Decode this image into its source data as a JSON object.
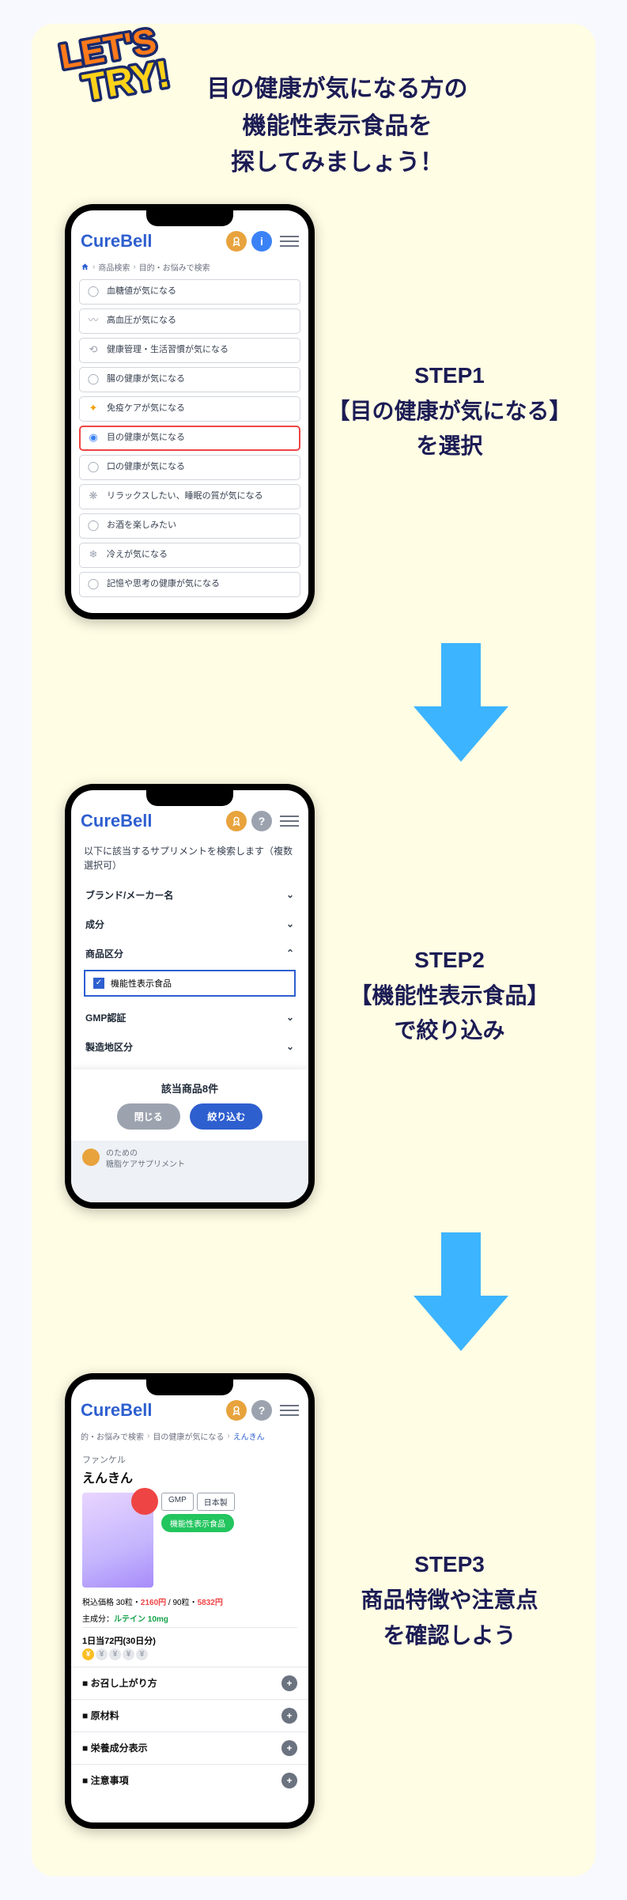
{
  "headline": {
    "l1": "目の健康が気になる方の",
    "l2": "機能性表示食品を",
    "l3": "探してみましょう！"
  },
  "badge_text": "LET'S TRY!",
  "app": {
    "logo": "CureBell"
  },
  "phone1": {
    "breadcrumb": {
      "a": "商品検索",
      "b": "目的・お悩みで検索"
    },
    "cats": [
      "血糖値が気になる",
      "高血圧が気になる",
      "健康管理・生活習慣が気になる",
      "腸の健康が気になる",
      "免疫ケアが気になる",
      "目の健康が気になる",
      "口の健康が気になる",
      "リラックスしたい、睡眠の質が気になる",
      "お酒を楽しみたい",
      "冷えが気になる",
      "記憶や思考の健康が気になる"
    ],
    "highlight_index": 5
  },
  "step1": {
    "title": "STEP1",
    "l1": "【目の健康が気になる】",
    "l2": "を選択"
  },
  "phone2": {
    "msg": "以下に該当するサプリメントを検索します（複数選択可）",
    "rows": [
      "ブランド/メーカー名",
      "成分",
      "商品区分",
      "GMP認証",
      "製造地区分"
    ],
    "checked_option": "機能性表示食品",
    "count_label": "該当商品8件",
    "btn_close": "閉じる",
    "btn_filter": "絞り込む",
    "bg_l1": "のための",
    "bg_l2": "糖脂ケアサプリメント"
  },
  "step2": {
    "title": "STEP2",
    "l1": "【機能性表示食品】",
    "l2": "で絞り込み"
  },
  "phone3": {
    "breadcrumb": {
      "a": "的・お悩みで検索",
      "b": "目の健康が気になる",
      "c": "えんきん"
    },
    "brand": "ファンケル",
    "name": "えんきん",
    "tags": {
      "gmp": "GMP",
      "jp": "日本製",
      "func": "機能性表示食品"
    },
    "price_prefix": "税込価格 30粒・",
    "price1": "2160円",
    "price_mid": " / 90粒・",
    "price2": "5832円",
    "ing_label": "主成分：",
    "ing_val": "ルテイン 10mg",
    "daily": "1日当72円(30日分)",
    "acc": [
      "お召し上がり方",
      "原材料",
      "栄養成分表示",
      "注意事項"
    ]
  },
  "step3": {
    "title": "STEP3",
    "l1": "商品特徴や注意点",
    "l2": "を確認しよう"
  }
}
